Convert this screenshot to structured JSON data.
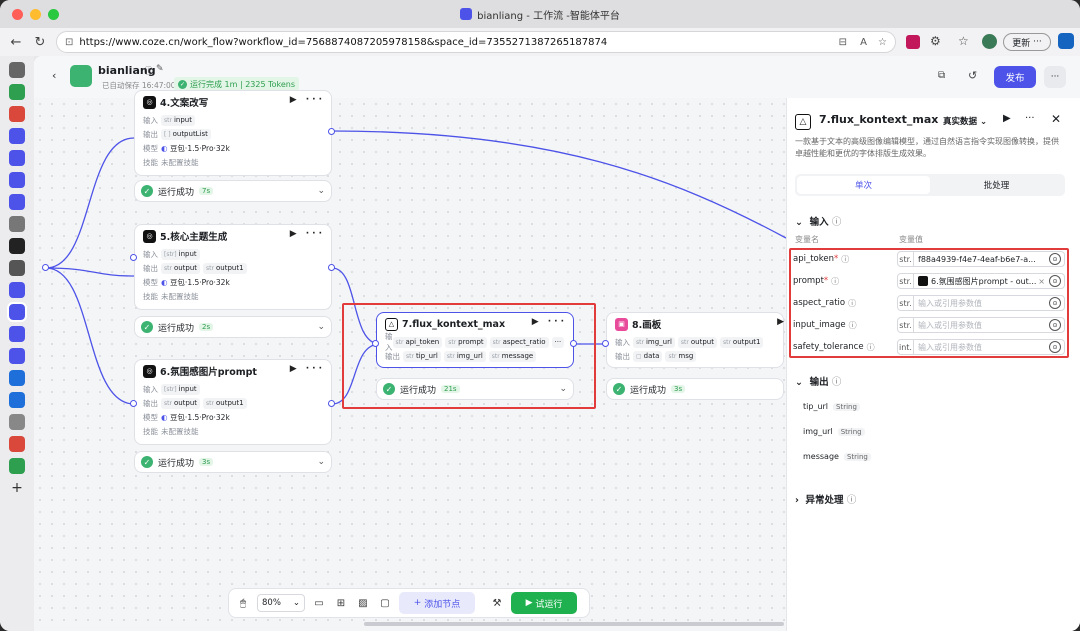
{
  "browser": {
    "title": "bianliang - 工作流 -智能体平台",
    "url": "https://www.coze.cn/work_flow?workflow_id=7568874087205978158&space_id=7355271387265187874",
    "update_label": "更新",
    "reader_label": "A"
  },
  "header": {
    "name": "bianliang",
    "autosave": "已自动保存 16:47:00",
    "run_status": "运行完成 1m | 2325 Tokens",
    "publish_label": "发布",
    "more": "···"
  },
  "nodes": {
    "n4": {
      "title": "4.文案改写",
      "in_label": "输入",
      "out_label": "输出",
      "model_label": "模型",
      "skill_label": "技能",
      "in_tag": "input",
      "in_type": "str",
      "out_tag": "outputList",
      "out_type": "[ ]",
      "model": "豆包·1.5·Pro·32k",
      "skill": "未配置技能",
      "status": "运行成功",
      "dur": "7s"
    },
    "n5": {
      "title": "5.核心主题生成",
      "in_label": "输入",
      "out_label": "输出",
      "model_label": "模型",
      "skill_label": "技能",
      "in_tag": "input",
      "in_type": "[str]",
      "out_tag1": "output",
      "out_tag2": "output1",
      "out_type": "str",
      "model": "豆包·1.5·Pro·32k",
      "skill": "未配置技能",
      "status": "运行成功",
      "dur": "2s"
    },
    "n6": {
      "title": "6.氛围感图片prompt",
      "in_label": "输入",
      "out_label": "输出",
      "model_label": "模型",
      "skill_label": "技能",
      "in_tag": "input",
      "in_type": "[str]",
      "out_tag1": "output",
      "out_tag2": "output1",
      "out_type": "str",
      "model": "豆包·1.5·Pro·32k",
      "skill": "未配置技能",
      "status": "运行成功",
      "dur": "3s"
    },
    "n7": {
      "title": "7.flux_kontext_max",
      "in_label": "输入",
      "out_label": "输出",
      "in_tags": [
        "api_token",
        "prompt",
        "aspect_ratio"
      ],
      "in_more": "···",
      "out_tags": [
        "tip_url",
        "img_url",
        "message"
      ],
      "type": "str",
      "status": "运行成功",
      "dur": "21s"
    },
    "n8": {
      "title": "8.画板",
      "in_label": "输入",
      "out_label": "输出",
      "in_tags": [
        "img_url",
        "output",
        "output1"
      ],
      "out_tags": [
        "data",
        "msg"
      ],
      "type": "str",
      "status": "运行成功",
      "dur": "3s"
    }
  },
  "panel": {
    "title": "7.flux_kontext_max",
    "mode": "真实数据",
    "desc": "一款基于文本的高级图像编辑模型，通过自然语言指令实现图像转换，提供卓越性能和更优的字体排版生成效果。",
    "tabs": [
      "单次",
      "批处理"
    ],
    "input_section": "输入",
    "col_name": "变量名",
    "col_value": "变量值",
    "params": [
      {
        "name": "api_token",
        "required": true,
        "type": "str.",
        "value": "f88a4939-f4e7-4eaf-b6e7-a...",
        "placeholder": false
      },
      {
        "name": "prompt",
        "required": true,
        "type": "str.",
        "value": "6.氛围感图片prompt - out...",
        "placeholder": false,
        "is_ref": true
      },
      {
        "name": "aspect_ratio",
        "required": false,
        "type": "str.",
        "value": "输入或引用参数值",
        "placeholder": true
      },
      {
        "name": "input_image",
        "required": false,
        "type": "str.",
        "value": "输入或引用参数值",
        "placeholder": true
      },
      {
        "name": "safety_tolerance",
        "required": false,
        "type": "int.",
        "value": "输入或引用参数值",
        "placeholder": true
      }
    ],
    "output_section": "输出",
    "outputs": [
      {
        "name": "tip_url",
        "type": "String"
      },
      {
        "name": "img_url",
        "type": "String"
      },
      {
        "name": "message",
        "type": "String"
      }
    ],
    "exception_section": "异常处理"
  },
  "toolbar": {
    "zoom": "80%",
    "add_node": "添加节点",
    "run": "试运行"
  },
  "colors": {
    "accent": "#4d53e8",
    "success": "#3cb371",
    "highlight": "#e23b3b"
  }
}
